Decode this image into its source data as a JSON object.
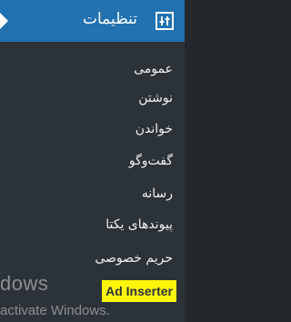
{
  "header": {
    "title": "تنظیمات",
    "icon": "settings-sliders-icon",
    "accent": "#2271b1"
  },
  "items": [
    {
      "label": "عمومی"
    },
    {
      "label": "نوشتن"
    },
    {
      "label": "خواندن"
    },
    {
      "label": "گفت‌وگو"
    },
    {
      "label": "رسانه"
    },
    {
      "label": "پیوندهای یکتا"
    },
    {
      "label": "حریم خصوصی"
    },
    {
      "label": "Ad Inserter",
      "highlight": "#fcf50b"
    }
  ],
  "watermark": {
    "line1": "dows",
    "line2": "activate Windows."
  }
}
